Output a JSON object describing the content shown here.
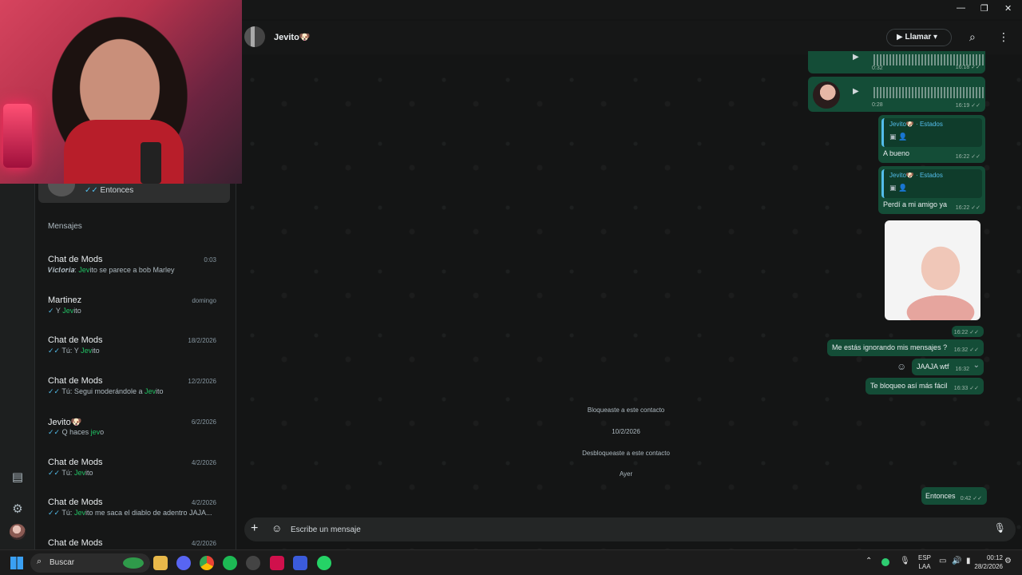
{
  "window": {
    "minimize": "—",
    "restore": "❐",
    "close": "✕"
  },
  "header": {
    "contact_name": "Jevito🐶",
    "call_label": "Llamar ▾",
    "video_icon": "video-icon",
    "search_icon": "search-icon",
    "menu_icon": "kebab-menu-icon"
  },
  "sidebar": {
    "pinned_preview": "✓✓ Entonces",
    "section_title": "Mensajes",
    "chats": [
      {
        "name": "Chat de Mods",
        "time": "0:03",
        "preview_prefix": "𝑽𝒊𝒄𝒕𝒐𝒓𝒊𝒂: ",
        "preview_hl": "Jev",
        "preview_rest": "ito se parece a bob Marley",
        "check": ""
      },
      {
        "name": "Martinez",
        "time": "domingo",
        "preview_prefix": "✓ Y ",
        "preview_hl": "Jev",
        "preview_rest": "ito",
        "check": ""
      },
      {
        "name": "Chat de Mods",
        "time": "18/2/2026",
        "preview_prefix": "✓✓ Tú: Y ",
        "preview_hl": "Jev",
        "preview_rest": "ito",
        "check": ""
      },
      {
        "name": "Chat de Mods",
        "time": "12/2/2026",
        "preview_prefix": "✓✓ Tú: Segui moderándole a ",
        "preview_hl": "Jev",
        "preview_rest": "ito",
        "check": ""
      },
      {
        "name": "Jevito🐶",
        "time": "6/2/2026",
        "preview_prefix": "✓✓ Q haces ",
        "preview_hl": "jev",
        "preview_rest": "o",
        "check": ""
      },
      {
        "name": "Chat de Mods",
        "time": "4/2/2026",
        "preview_prefix": "✓✓ Tú: ",
        "preview_hl": "Jev",
        "preview_rest": "ito",
        "check": ""
      },
      {
        "name": "Chat de Mods",
        "time": "4/2/2026",
        "preview_prefix": "✓✓ Tú: ",
        "preview_hl": "Jev",
        "preview_rest": "ito me saca el diablo de adentro JAJA...",
        "check": ""
      },
      {
        "name": "Chat de Mods",
        "time": "4/2/2026",
        "preview_prefix": "",
        "preview_hl": "",
        "preview_rest": "",
        "check": ""
      }
    ]
  },
  "messages": {
    "voice1": {
      "duration": "0:32",
      "time": "16:18 ✓✓"
    },
    "voice2": {
      "duration": "0:28",
      "time": "16:19 ✓✓"
    },
    "reply1": {
      "quote_name": "Jevito🐶 · Estados",
      "quote_icons": "▣ 👤",
      "text": "A bueno",
      "time": "16:22 ✓✓"
    },
    "reply2": {
      "quote_name": "Jevito🐶 · Estados",
      "quote_icons": "▣ 👤",
      "text": "Perdí a mi amigo ya",
      "time": "16:22 ✓✓"
    },
    "sticker_time": "16:22 ✓✓",
    "m1": {
      "text": "Me estás ignorando mis mensajes ?",
      "time": "16:32 ✓✓"
    },
    "m2": {
      "text": "JAAJA wtf",
      "time": "16:32"
    },
    "m3": {
      "text": "Te bloqueo así más fácil",
      "time": "16:33 ✓✓"
    },
    "sys1": "Bloqueaste a este contacto",
    "date1": "10/2/2026",
    "sys2": "Desbloqueaste a este contacto",
    "date2": "Ayer",
    "m4": {
      "text": "Entonces",
      "time": "0:42 ✓✓"
    }
  },
  "composer": {
    "placeholder": "Escribe un mensaje"
  },
  "taskbar": {
    "search_label": "Buscar",
    "lang_line1": "ESP",
    "lang_line2": "LAA",
    "time": "00:12",
    "date": "28/2/2026"
  }
}
